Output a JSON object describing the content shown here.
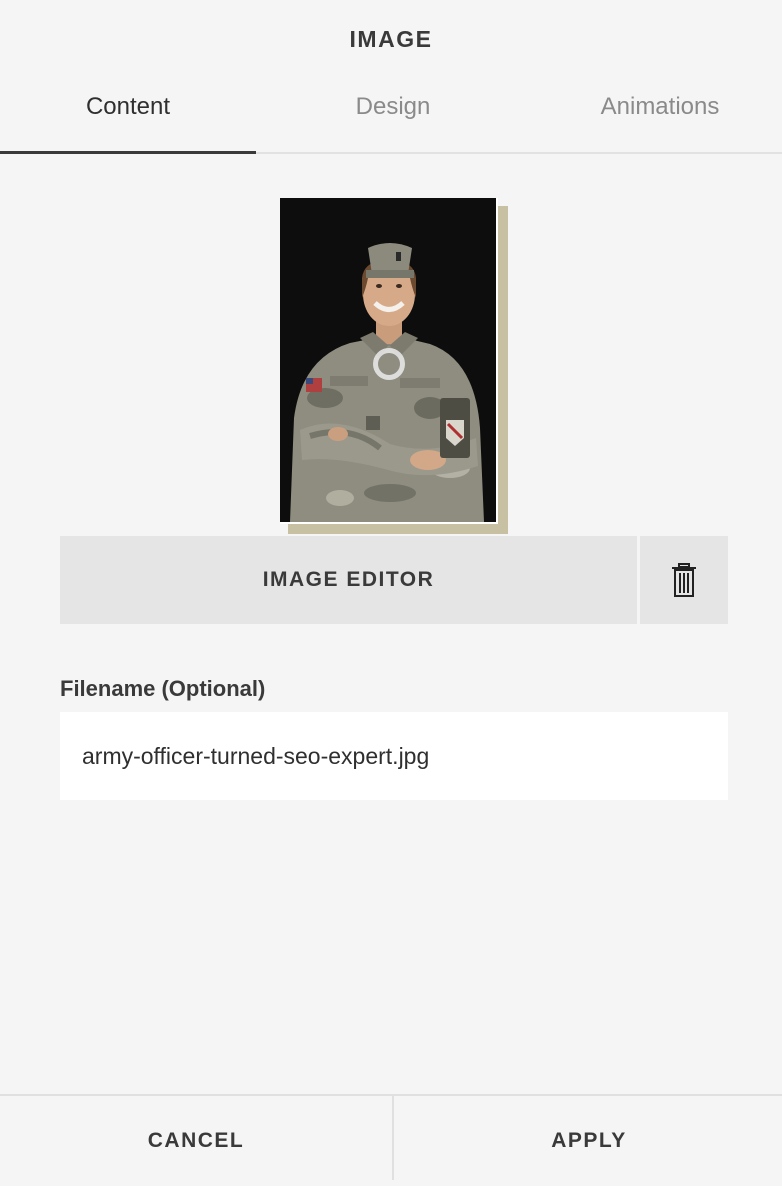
{
  "panel": {
    "title": "IMAGE"
  },
  "tabs": [
    {
      "label": "Content",
      "active": true
    },
    {
      "label": "Design",
      "active": false
    },
    {
      "label": "Animations",
      "active": false
    }
  ],
  "image": {
    "frame_accent_color": "#c8c0a3",
    "background_color": "#0d0d0d"
  },
  "editor": {
    "button_label": "IMAGE EDITOR",
    "delete_icon": "trash-icon"
  },
  "filename": {
    "label": "Filename (Optional)",
    "value": "army-officer-turned-seo-expert.jpg"
  },
  "footer": {
    "cancel_label": "CANCEL",
    "apply_label": "APPLY"
  }
}
